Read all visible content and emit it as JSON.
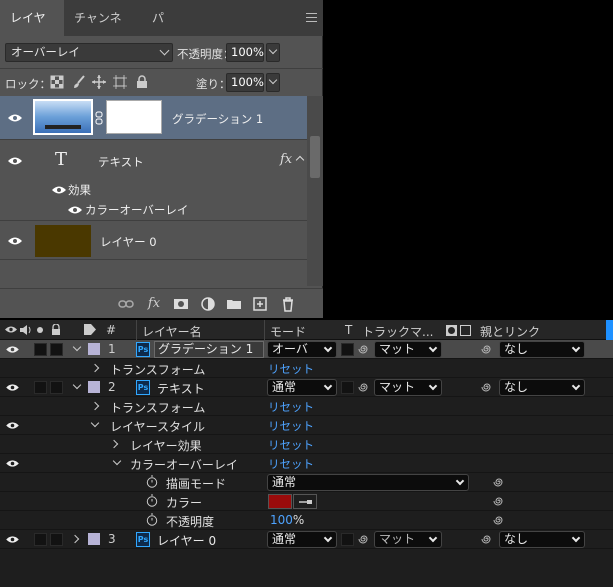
{
  "ps": {
    "tabs": [
      "レイヤー",
      "チャンネル",
      "パス"
    ],
    "blend_mode": "オーバーレイ",
    "opacity_label": "不透明度：",
    "opacity_value": "100%",
    "lock_label": "ロック：",
    "fill_label": "塗り：",
    "fill_value": "100%",
    "layers": [
      {
        "name": "グラデーション 1"
      },
      {
        "name": "テキスト",
        "fx": "fx",
        "effects_label": "効果",
        "effect_item": "カラーオーバーレイ"
      },
      {
        "name": "レイヤー 0"
      }
    ],
    "text_layer_glyph": "T",
    "footer_fx": "fx"
  },
  "ae": {
    "header": {
      "hash": "#",
      "layer_name": "レイヤー名",
      "mode": "モード",
      "t": "T",
      "track_matte": "トラックマ...",
      "parent_link": "親とリンク"
    },
    "layers": [
      {
        "num": "1",
        "name": "グラデーション 1",
        "mode": "オーバ",
        "matte": "マット",
        "parent": "なし"
      },
      {
        "num": "2",
        "name": "テキスト",
        "mode": "通常",
        "matte": "マット",
        "parent": "なし"
      },
      {
        "num": "3",
        "name": "レイヤー 0",
        "mode": "通常",
        "matte": "マット",
        "parent": "なし"
      }
    ],
    "transform": "トランスフォーム",
    "reset": "リセット",
    "layer_styles": "レイヤースタイル",
    "layer_effect": "レイヤー効果",
    "color_overlay": "カラーオーバーレイ",
    "blend_mode_label": "描画モード",
    "blend_mode_value": "通常",
    "color_label": "カラー",
    "opacity_label": "不透明度",
    "opacity_value": "100",
    "opacity_unit": "%",
    "swatch_color": "#9a0b0b",
    "accent_color": "#4ea3ff"
  }
}
